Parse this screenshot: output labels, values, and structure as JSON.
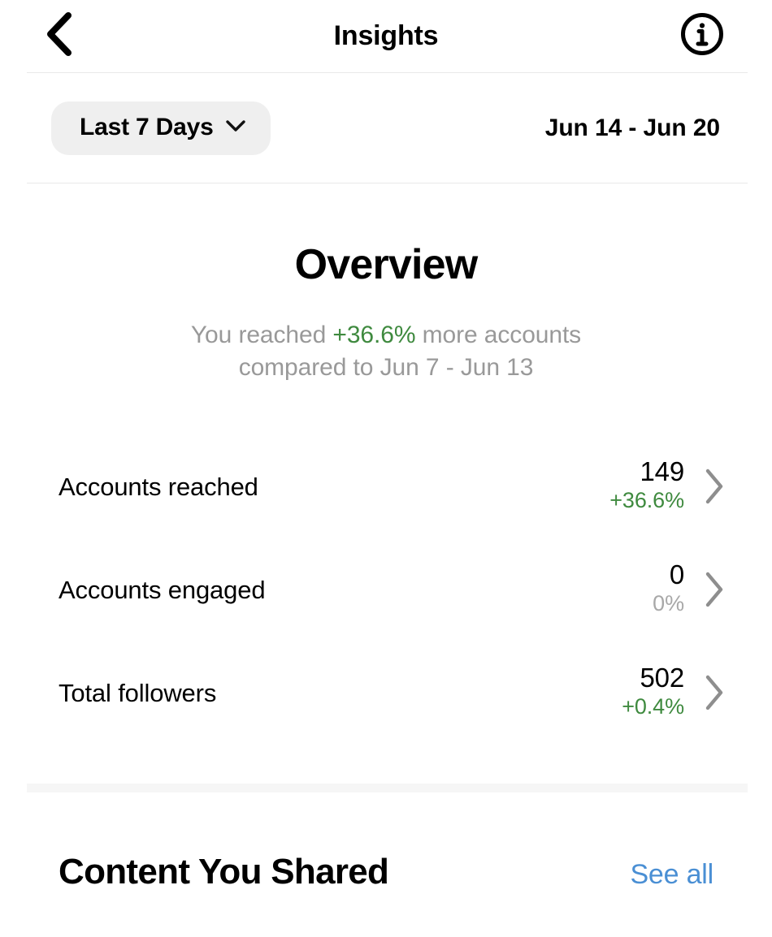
{
  "navbar": {
    "back_icon": "chevron-left-icon",
    "title": "Insights",
    "info_icon": "info-circle-icon"
  },
  "filter_bar": {
    "range_label": "Last 7 Days",
    "range_chevron_icon": "chevron-down-icon",
    "date_range": "Jun 14 - Jun 20"
  },
  "overview": {
    "title": "Overview",
    "summary_prefix": "You reached ",
    "summary_delta": "+36.6%",
    "summary_suffix": " more accounts",
    "summary_line2": "compared to Jun 7 - Jun 13",
    "metrics": [
      {
        "label": "Accounts reached",
        "value": "149",
        "delta": "+36.6%",
        "delta_state": "up",
        "chevron_icon": "chevron-right-icon"
      },
      {
        "label": "Accounts engaged",
        "value": "0",
        "delta": "0%",
        "delta_state": "flat",
        "chevron_icon": "chevron-right-icon"
      },
      {
        "label": "Total followers",
        "value": "502",
        "delta": "+0.4%",
        "delta_state": "up",
        "chevron_icon": "chevron-right-icon"
      }
    ]
  },
  "content_section": {
    "title": "Content You Shared",
    "see_all_label": "See all"
  },
  "colors": {
    "positive_green": "#3f8a3f",
    "neutral_gray": "#a8a8a8",
    "link_blue": "#4a8fd4",
    "pill_bg": "#efefef",
    "subtitle_gray": "#999999",
    "divider": "#e9e9e9",
    "section_band": "#f6f6f6"
  }
}
